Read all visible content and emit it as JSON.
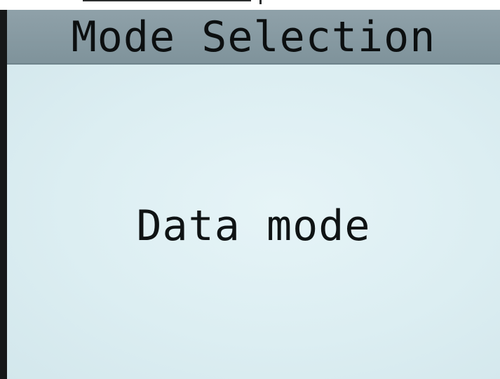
{
  "screen": {
    "title": "Mode Selection",
    "current_mode": "Data mode"
  },
  "colors": {
    "title_bar": "#8a9ca4",
    "screen_background": "#dfeef2",
    "text": "#0c0f10"
  }
}
